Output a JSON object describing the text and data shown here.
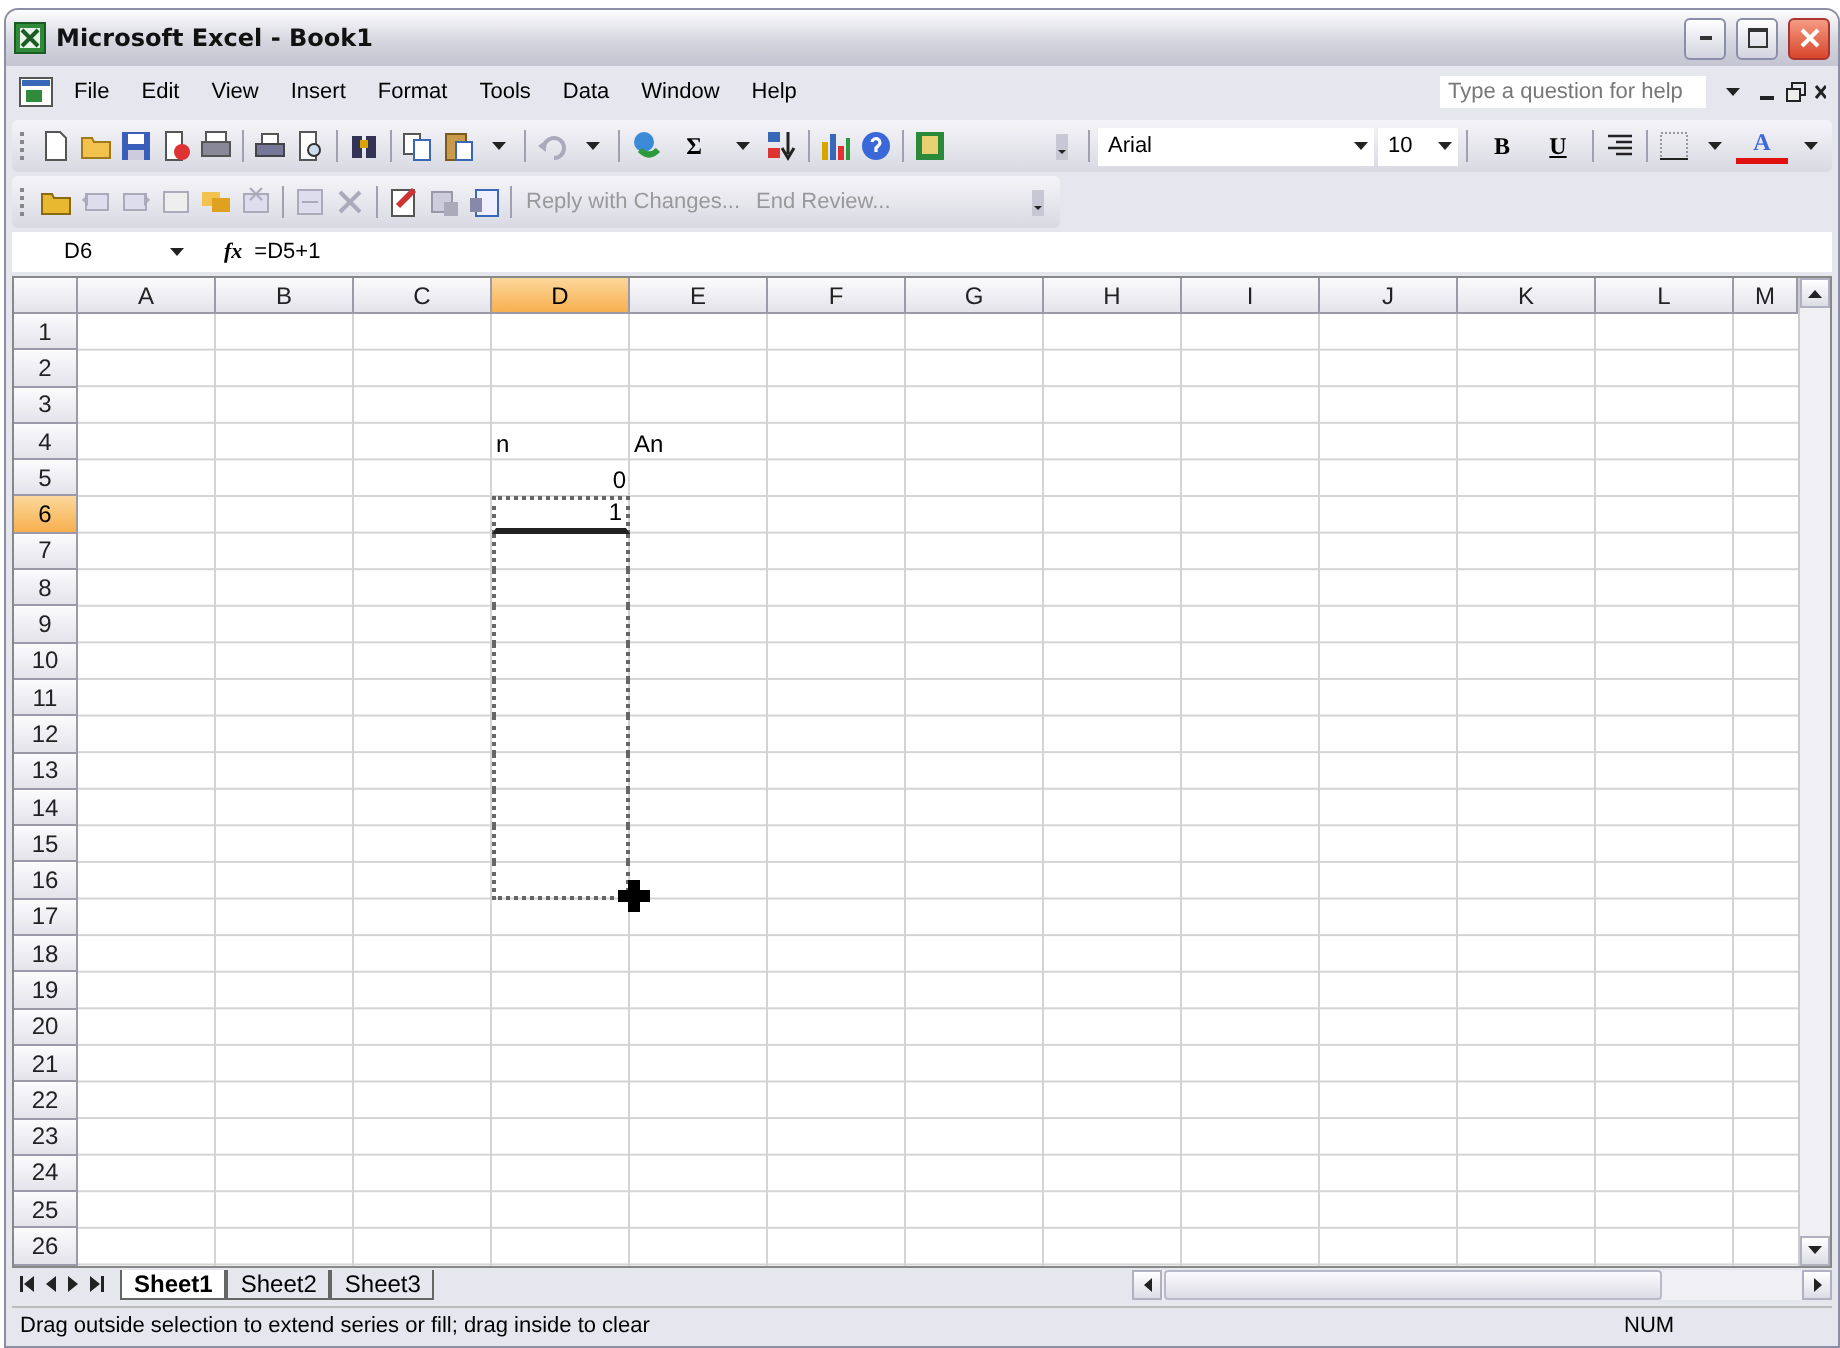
{
  "window": {
    "title": "Microsoft Excel - Book1"
  },
  "menu": {
    "items": [
      "File",
      "Edit",
      "View",
      "Insert",
      "Format",
      "Tools",
      "Data",
      "Window",
      "Help"
    ],
    "help_placeholder": "Type a question for help"
  },
  "standard_toolbar": {
    "autosum": "Σ"
  },
  "formatting_toolbar": {
    "font": "Arial",
    "size": "10",
    "bold": "B",
    "underline": "U",
    "font_color": "A"
  },
  "reviewing_toolbar": {
    "buttons": [
      {
        "label": "Reply with Changes...",
        "disabled": true
      },
      {
        "label": "End Review...",
        "disabled": true
      }
    ]
  },
  "formula_bar": {
    "name_box": "D6",
    "function_label": "fx",
    "formula": "=D5+1"
  },
  "sheet": {
    "columns": [
      {
        "label": "A",
        "selected": false
      },
      {
        "label": "B",
        "selected": false
      },
      {
        "label": "C",
        "selected": false
      },
      {
        "label": "D",
        "selected": true
      },
      {
        "label": "E",
        "selected": false
      },
      {
        "label": "F",
        "selected": false
      },
      {
        "label": "G",
        "selected": false
      },
      {
        "label": "H",
        "selected": false
      },
      {
        "label": "I",
        "selected": false
      },
      {
        "label": "J",
        "selected": false
      },
      {
        "label": "K",
        "selected": false
      },
      {
        "label": "L",
        "selected": false
      },
      {
        "label": "M",
        "selected": false
      }
    ],
    "rows": [
      {
        "label": "1",
        "selected": false,
        "in_fill_range": false
      },
      {
        "label": "2",
        "selected": false,
        "in_fill_range": false
      },
      {
        "label": "3",
        "selected": false,
        "in_fill_range": false
      },
      {
        "label": "4",
        "selected": false,
        "in_fill_range": false,
        "cells": [
          null,
          null,
          null,
          {
            "text": "n",
            "kind": "text"
          },
          {
            "text": "An",
            "kind": "text"
          }
        ]
      },
      {
        "label": "5",
        "selected": false,
        "in_fill_range": false,
        "cells": [
          null,
          null,
          null,
          {
            "text": "0",
            "kind": "number"
          }
        ]
      },
      {
        "label": "6",
        "selected": true,
        "in_fill_range": true,
        "cells": [
          null,
          null,
          null,
          {
            "text": "1",
            "kind": "number"
          }
        ]
      },
      {
        "label": "7",
        "selected": false,
        "in_fill_range": true
      },
      {
        "label": "8",
        "selected": false,
        "in_fill_range": true
      },
      {
        "label": "9",
        "selected": false,
        "in_fill_range": true
      },
      {
        "label": "10",
        "selected": false,
        "in_fill_range": true
      },
      {
        "label": "11",
        "selected": false,
        "in_fill_range": true
      },
      {
        "label": "12",
        "selected": false,
        "in_fill_range": true
      },
      {
        "label": "13",
        "selected": false,
        "in_fill_range": true
      },
      {
        "label": "14",
        "selected": false,
        "in_fill_range": true
      },
      {
        "label": "15",
        "selected": false,
        "in_fill_range": true
      },
      {
        "label": "16",
        "selected": false,
        "in_fill_range": true
      },
      {
        "label": "17",
        "selected": false,
        "in_fill_range": false
      },
      {
        "label": "18",
        "selected": false,
        "in_fill_range": false
      },
      {
        "label": "19",
        "selected": false,
        "in_fill_range": false
      },
      {
        "label": "20",
        "selected": false,
        "in_fill_range": false
      },
      {
        "label": "21",
        "selected": false,
        "in_fill_range": false
      },
      {
        "label": "22",
        "selected": false,
        "in_fill_range": false
      },
      {
        "label": "23",
        "selected": false,
        "in_fill_range": false
      },
      {
        "label": "24",
        "selected": false,
        "in_fill_range": false
      },
      {
        "label": "25",
        "selected": false,
        "in_fill_range": false
      },
      {
        "label": "26",
        "selected": false,
        "in_fill_range": false
      }
    ]
  },
  "sheet_tabs": [
    {
      "label": "Sheet1",
      "selected": true
    },
    {
      "label": "Sheet2",
      "selected": false
    },
    {
      "label": "Sheet3",
      "selected": false
    }
  ],
  "status_bar": {
    "message": "Drag outside selection to extend series or fill; drag inside to clear",
    "indicators": [
      "NUM"
    ]
  }
}
